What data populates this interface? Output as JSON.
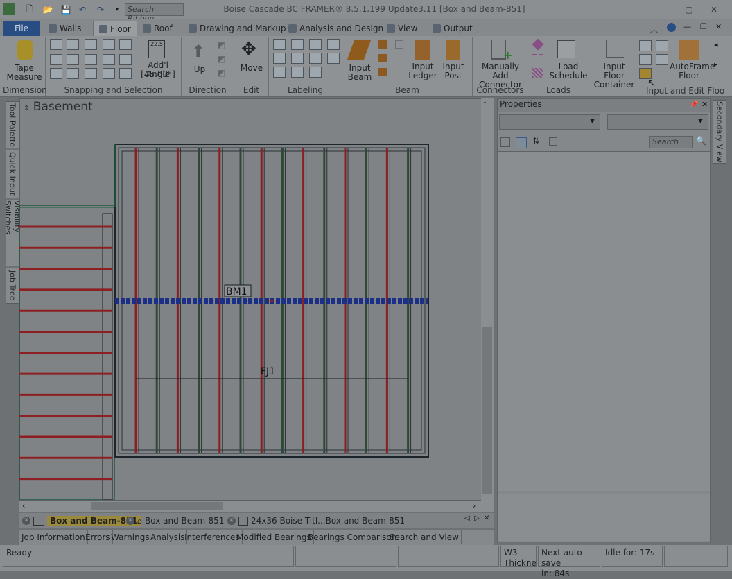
{
  "window": {
    "title": "Boise Cascade BC FRAMER® 8.5.1.199 Update3.11  [Box and Beam-851]"
  },
  "quick_access": {
    "search_placeholder": "Search Ribbon"
  },
  "tabs": [
    {
      "label": "File"
    },
    {
      "label": "Walls"
    },
    {
      "label": "Floor"
    },
    {
      "label": "Roof"
    },
    {
      "label": "Drawing and Markup"
    },
    {
      "label": "Analysis and Design"
    },
    {
      "label": "View"
    },
    {
      "label": "Output"
    }
  ],
  "ribbon": {
    "dimension": {
      "label": "Dimension",
      "tape_measure": "Tape Measure"
    },
    "snapping": {
      "label": "Snapping and Selection",
      "addl_angle": "Add'l Angle",
      "angle_value": "[45.00°]",
      "angle_badge": "22.5"
    },
    "direction": {
      "label": "Direction",
      "up": "Up"
    },
    "edit": {
      "label": "Edit",
      "move": "Move"
    },
    "labeling": {
      "label": "Labeling"
    },
    "beam": {
      "label": "Beam",
      "input_beam": "Input Beam",
      "input_ledger": "Input Ledger",
      "input_post": "Input Post"
    },
    "connectors": {
      "label": "Connectors",
      "manually_add": "Manually Add Connector"
    },
    "loads": {
      "label": "Loads",
      "load_schedule": "Load Schedule"
    },
    "input_edit": {
      "label": "Input and Edit Floo",
      "floor_container": "Input Floor Container",
      "autoframe": "AutoFrame Floor"
    }
  },
  "left_dock": [
    "Tool Palette",
    "Quick Input",
    "Visibility Switches",
    "Job Tree"
  ],
  "canvas": {
    "level": "Basement",
    "beam_label": "BM1",
    "joist_label": "FJ1"
  },
  "properties": {
    "title": "Properties",
    "search_placeholder": "Search"
  },
  "secondary_view": "Secondary View",
  "doc_tabs": [
    "Box and Beam-851",
    "Box and Beam-851",
    "24x36 Boise Titl...Box and Beam-851"
  ],
  "bottom_tabs": [
    "Job Information",
    "Errors",
    "Warnings",
    "Analysis",
    "Interferences",
    "Modified Bearings",
    "Bearings Comparison",
    "Search and View"
  ],
  "status": {
    "ready": "Ready",
    "w3a": "W3",
    "w3b": "Thickne",
    "autosave_a": "Next auto save",
    "autosave_b": "in: 84s",
    "idle": "Idle for: 17s"
  },
  "colors": {
    "joist": "#8b1f22",
    "beam": "#1c2f86",
    "file_tab": "#274d83"
  }
}
